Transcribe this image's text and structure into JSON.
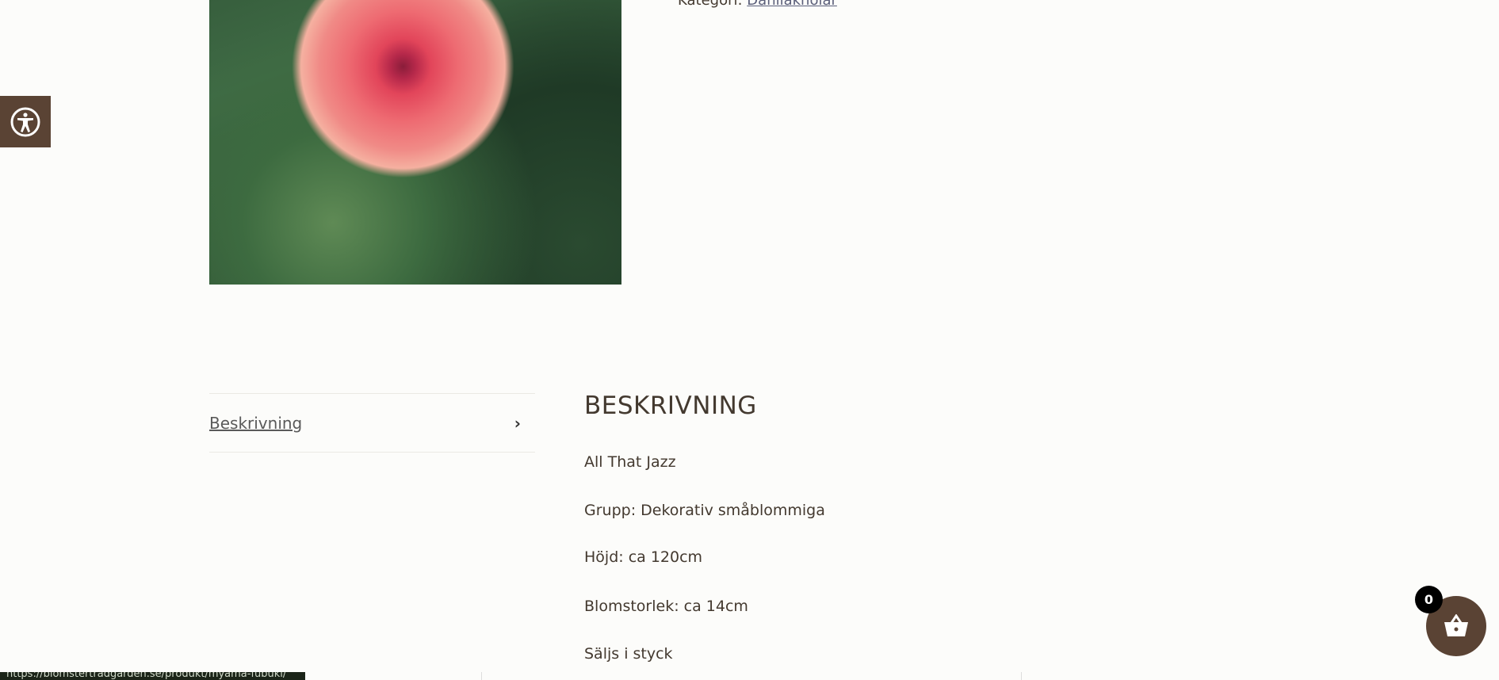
{
  "product": {
    "category_label": "Kategori:",
    "category_link": "Dahliaknölar"
  },
  "tabs": [
    {
      "label": "Beskrivning",
      "icon": "chevron-right-icon"
    }
  ],
  "description": {
    "heading": "BESKRIVNING",
    "paragraphs": [
      "All That Jazz",
      "Grupp: Dekorativ småblommiga",
      "Höjd: ca 120cm",
      "Blomstorlek: ca 14cm",
      "Säljs i styck"
    ]
  },
  "cart": {
    "count": "0",
    "icon": "basket-icon"
  },
  "accessibility": {
    "icon": "accessibility-icon"
  },
  "status_bar": {
    "url": "https://blomstertradgarden.se/produkt/myama-fubuki/"
  },
  "colors": {
    "brand_brown": "#5a4334",
    "background": "#fcfcfa",
    "text": "#43392f"
  }
}
